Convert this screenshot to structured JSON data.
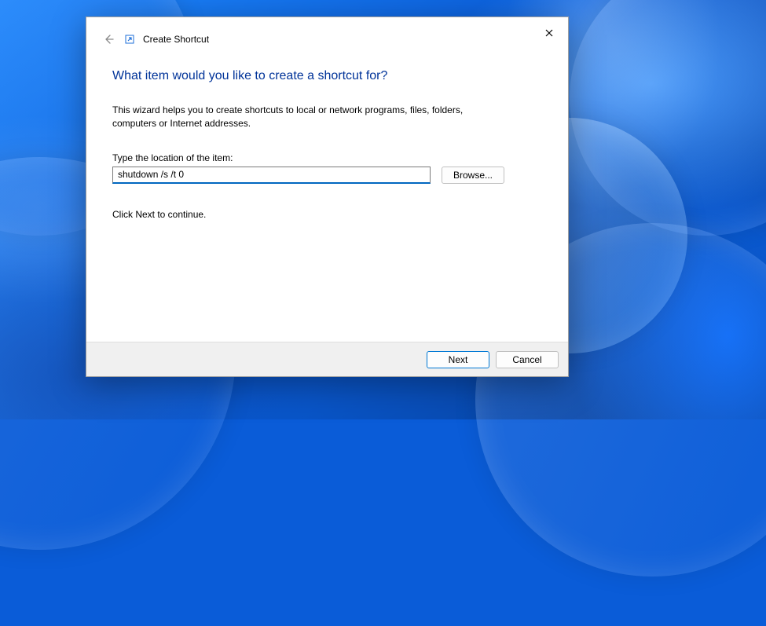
{
  "dialog": {
    "title": "Create Shortcut",
    "heading": "What item would you like to create a shortcut for?",
    "description": "This wizard helps you to create shortcuts to local or network programs, files, folders, computers or Internet addresses.",
    "field_label": "Type the location of the item:",
    "location_value": "shutdown /s /t 0",
    "browse_label": "Browse...",
    "continue_text": "Click Next to continue.",
    "next_label": "Next",
    "cancel_label": "Cancel"
  }
}
